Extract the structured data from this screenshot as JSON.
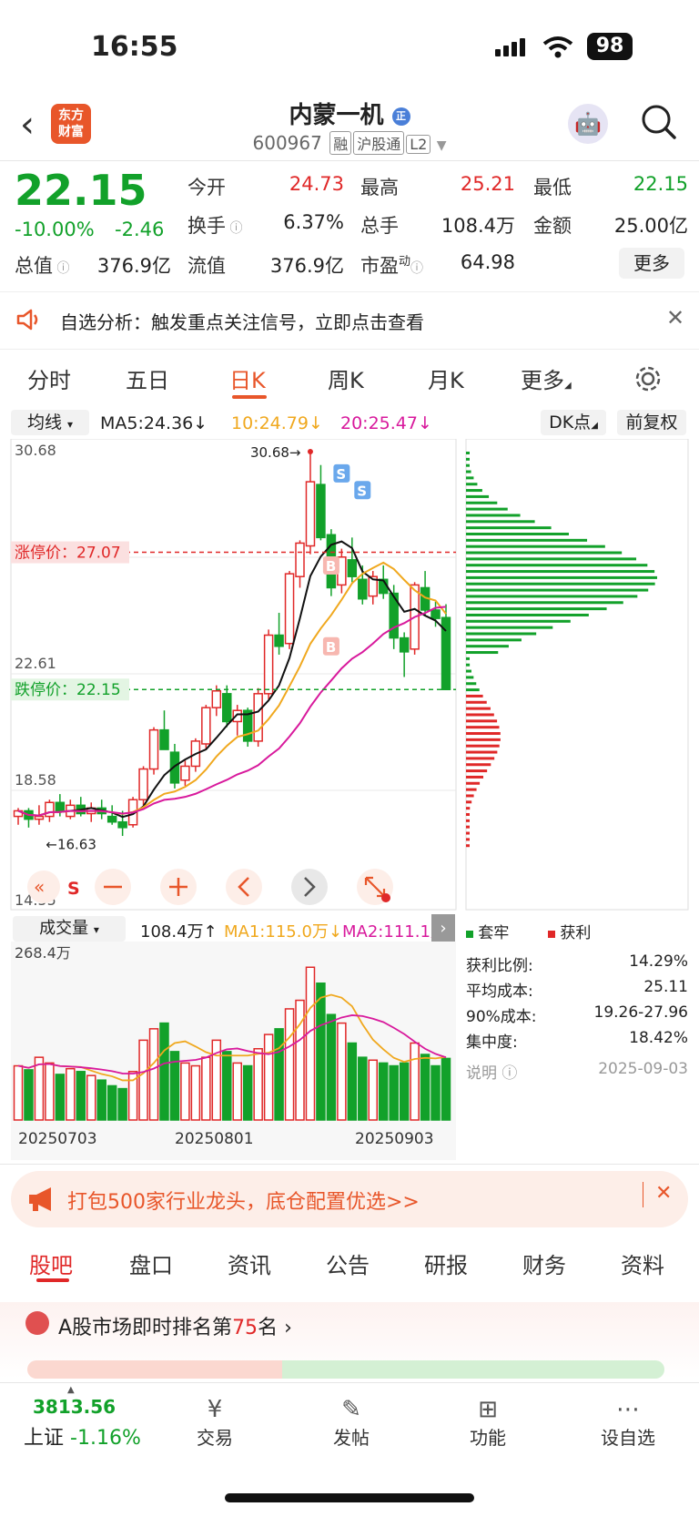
{
  "status": {
    "time": "16:55",
    "battery": "98"
  },
  "header": {
    "logo": [
      "东方",
      "财富"
    ],
    "name": "内蒙一机",
    "name_badge": "正",
    "code": "600967",
    "tags": [
      "融",
      "沪股通",
      "L2"
    ]
  },
  "quote": {
    "price": "22.15",
    "change_pct": "-10.00%",
    "change": "-2.46",
    "rows": [
      [
        {
          "label": "今开",
          "value": "24.73",
          "color": "red"
        },
        {
          "label": "最高",
          "value": "25.21",
          "color": "red"
        },
        {
          "label": "最低",
          "value": "22.15",
          "color": "green"
        }
      ],
      [
        {
          "label": "换手",
          "value": "6.37%",
          "color": "black"
        },
        {
          "label": "总手",
          "value": "108.4万",
          "color": "black"
        },
        {
          "label": "金额",
          "value": "25.00亿",
          "color": "black"
        }
      ],
      [
        {
          "label": "总值",
          "value": "376.9亿",
          "color": "black"
        },
        {
          "label": "流值",
          "value": "376.9亿",
          "color": "black"
        },
        {
          "label": "市盈",
          "label_sup": "动",
          "value": "64.98",
          "color": "black"
        }
      ]
    ],
    "more_label": "更多"
  },
  "notice": {
    "text": "自选分析：触发重点关注信号，立即点击查看"
  },
  "tabs": [
    "分时",
    "五日",
    "日K",
    "周K",
    "月K",
    "更多"
  ],
  "active_tab": 2,
  "ma": {
    "type": "均线",
    "ma5": "MA5:24.36",
    "ma10": "10:24.79",
    "ma20": "20:25.47",
    "dk": "DK点",
    "adjust": "前复权"
  },
  "colors": {
    "up": "#e02828",
    "down": "#12a12a",
    "ma5": "#111111",
    "ma10": "#f0a81e",
    "ma20": "#d8199c",
    "accent": "#e8562a"
  },
  "kchart_labels": {
    "axis": [
      "30.68",
      "22.61",
      "18.58",
      "14.55"
    ],
    "limit_up": "涨停价：27.07",
    "limit_down": "跌停价：22.15",
    "high_mark": "30.68",
    "low_mark": "16.63",
    "buy": "B",
    "sell": "S"
  },
  "chart_data": {
    "type": "candlestick",
    "y_range": [
      14.55,
      30.68
    ],
    "limit_up": 27.07,
    "limit_down": 22.15,
    "high": 30.68,
    "low": 16.63,
    "candles": [
      [
        17.6,
        17.9,
        17.3,
        17.8
      ],
      [
        17.8,
        17.9,
        17.2,
        17.5
      ],
      [
        17.5,
        18.0,
        17.3,
        17.6
      ],
      [
        17.6,
        18.2,
        17.4,
        18.1
      ],
      [
        18.1,
        18.4,
        17.6,
        17.8
      ],
      [
        17.6,
        18.2,
        17.5,
        18.0
      ],
      [
        18.0,
        18.3,
        17.6,
        17.7
      ],
      [
        17.7,
        18.1,
        17.4,
        17.9
      ],
      [
        17.9,
        18.2,
        17.5,
        17.7
      ],
      [
        17.6,
        18.0,
        17.3,
        17.4
      ],
      [
        17.4,
        17.8,
        16.9,
        17.2
      ],
      [
        17.3,
        18.3,
        17.2,
        18.2
      ],
      [
        18.2,
        19.4,
        18.0,
        19.3
      ],
      [
        19.3,
        20.8,
        19.1,
        20.7
      ],
      [
        20.7,
        21.4,
        20.2,
        20.0
      ],
      [
        19.9,
        20.2,
        18.6,
        18.8
      ],
      [
        18.9,
        19.6,
        18.7,
        19.4
      ],
      [
        19.4,
        20.4,
        19.2,
        20.3
      ],
      [
        20.2,
        21.6,
        20.0,
        21.5
      ],
      [
        21.5,
        22.3,
        21.2,
        22.1
      ],
      [
        22.0,
        22.3,
        20.8,
        21.0
      ],
      [
        21.0,
        21.6,
        20.5,
        21.4
      ],
      [
        21.4,
        21.5,
        20.1,
        20.3
      ],
      [
        20.3,
        22.2,
        20.1,
        22.0
      ],
      [
        22.0,
        24.3,
        21.8,
        24.1
      ],
      [
        24.1,
        24.9,
        23.4,
        23.7
      ],
      [
        23.8,
        26.4,
        23.6,
        26.3
      ],
      [
        26.2,
        27.5,
        25.8,
        27.4
      ],
      [
        27.3,
        30.68,
        27.0,
        29.6
      ],
      [
        29.5,
        30.2,
        27.5,
        27.6
      ],
      [
        27.7,
        27.9,
        25.5,
        25.8
      ],
      [
        25.9,
        27.2,
        25.6,
        26.9
      ],
      [
        26.8,
        27.6,
        26.0,
        26.2
      ],
      [
        26.1,
        26.6,
        25.2,
        25.4
      ],
      [
        25.5,
        26.4,
        25.2,
        26.2
      ],
      [
        26.1,
        26.6,
        25.4,
        25.6
      ],
      [
        25.6,
        25.9,
        23.6,
        24.0
      ],
      [
        24.0,
        24.2,
        22.6,
        23.5
      ],
      [
        23.6,
        26.0,
        23.4,
        25.9
      ],
      [
        25.8,
        26.4,
        24.8,
        25.0
      ],
      [
        25.0,
        25.3,
        24.4,
        24.7
      ],
      [
        24.73,
        25.21,
        22.15,
        22.15
      ]
    ],
    "volume_axis_max": "268.4万",
    "volume_label": "成交量",
    "volume_value": "108.4万",
    "vma1": "MA1:115.0万",
    "vma2": "MA2:111.1万",
    "volumes": [
      95,
      88,
      110,
      100,
      80,
      90,
      85,
      78,
      70,
      60,
      55,
      85,
      140,
      160,
      170,
      120,
      100,
      95,
      110,
      140,
      120,
      100,
      95,
      125,
      150,
      160,
      195,
      210,
      268,
      240,
      185,
      170,
      135,
      110,
      105,
      100,
      95,
      100,
      135,
      115,
      95,
      108
    ],
    "dates": [
      "20250703",
      "20250801",
      "20250903"
    ],
    "distribution": {
      "profit_levels": 20,
      "trapped_levels": 44
    }
  },
  "chip": {
    "legend": [
      "套牢",
      "获利"
    ],
    "stats": [
      {
        "label": "获利比例:",
        "value": "14.29%"
      },
      {
        "label": "平均成本:",
        "value": "25.11"
      },
      {
        "label": "90%成本:",
        "value": "19.26-27.96"
      },
      {
        "label": "集中度:",
        "value": "18.42%"
      }
    ],
    "note": "说明",
    "date": "2025-09-03"
  },
  "banner": {
    "text": "打包500家行业龙头，底仓配置优选>>"
  },
  "bottom_tabs": [
    "股吧",
    "盘口",
    "资讯",
    "公告",
    "研报",
    "财务",
    "资料"
  ],
  "rank": {
    "prefix": "A股市场即时排名第",
    "num": "75",
    "suffix": "名"
  },
  "nav": {
    "index_value": "3813.56",
    "index_name": "上证",
    "index_change": "-1.16%",
    "items": [
      "交易",
      "发帖",
      "功能",
      "设自选"
    ]
  }
}
